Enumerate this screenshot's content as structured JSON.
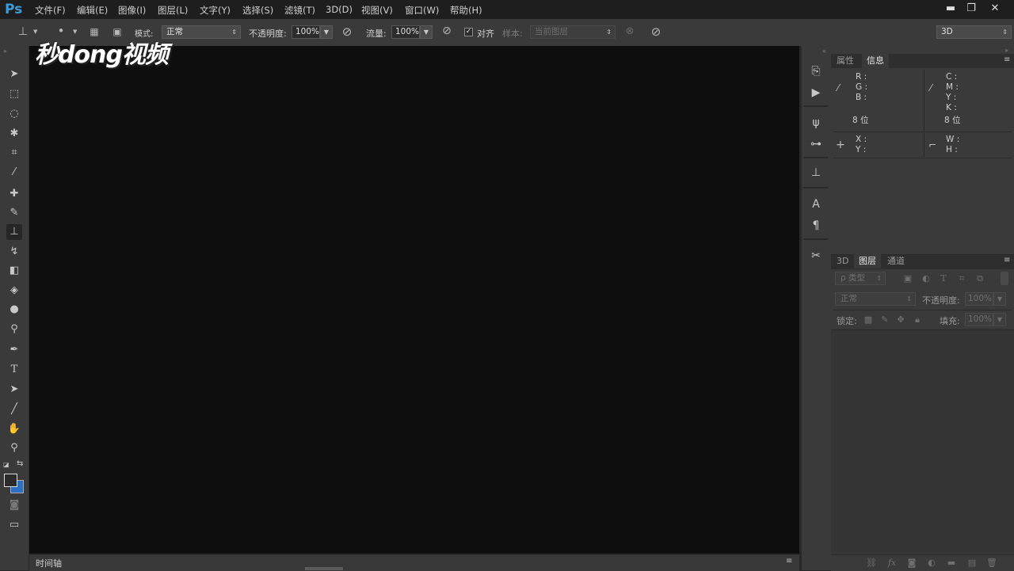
{
  "app": {
    "logo": "Ps"
  },
  "menu": [
    "文件(F)",
    "编辑(E)",
    "图像(I)",
    "图层(L)",
    "文字(Y)",
    "选择(S)",
    "滤镜(T)",
    "3D(D)",
    "视图(V)",
    "窗口(W)",
    "帮助(H)"
  ],
  "window_controls": {
    "minimize": "▬",
    "restore": "❐",
    "close": "✕"
  },
  "options": {
    "mode_label": "模式:",
    "mode_value": "正常",
    "opacity_label": "不透明度:",
    "opacity_value": "100%",
    "flow_label": "流量:",
    "flow_value": "100%",
    "align_label": "对齐",
    "align_checked": true,
    "sample_label": "样本:",
    "sample_value": "当前图层",
    "workspace": "3D"
  },
  "watermark": "秒dong视频",
  "timeline_label": "时间轴",
  "info_panel": {
    "tabs": [
      "属性",
      "信息"
    ],
    "active_tab": "信息",
    "rgb": "R :\nG :\nB :",
    "cmyk": "C :\nM :\nY :\nK :",
    "bit_left": "8 位",
    "bit_right": "8 位",
    "xy": "X :\nY :",
    "wh": "W :\nH :"
  },
  "layers_panel": {
    "tabs": [
      "3D",
      "图层",
      "通道"
    ],
    "active_tab": "图层",
    "filter_label": "ρ 类型",
    "blend_mode": "正常",
    "opacity_label": "不透明度:",
    "opacity_value": "100%",
    "lock_label": "锁定:",
    "fill_label": "填充:",
    "fill_value": "100%"
  },
  "colors": {
    "foreground": "#2b2b2b",
    "background": "#2f6fc0",
    "accent": "#3d9bd8"
  }
}
